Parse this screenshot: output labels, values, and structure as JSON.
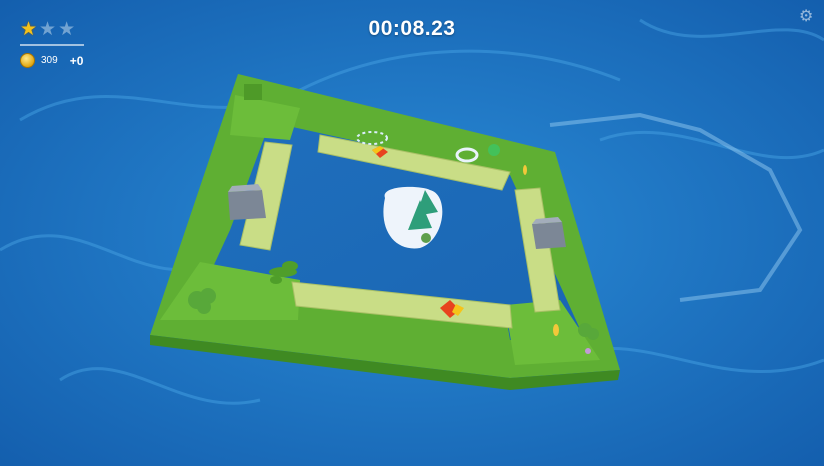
{
  "hud": {
    "stars_earned": 1,
    "stars_total": 3,
    "star_glyph": "★",
    "coins": "309",
    "coin_delta": "+0",
    "timer": "00:08.23",
    "settings_icon": "⚙"
  },
  "colors": {
    "water": "#1e78c4",
    "grass": "#6cbd3a",
    "wall": "#4f9e2a",
    "path": "#c9dd86",
    "rock": "#7c8796",
    "arrow_red": "#e8431e",
    "arrow_yellow": "#f6c419"
  }
}
